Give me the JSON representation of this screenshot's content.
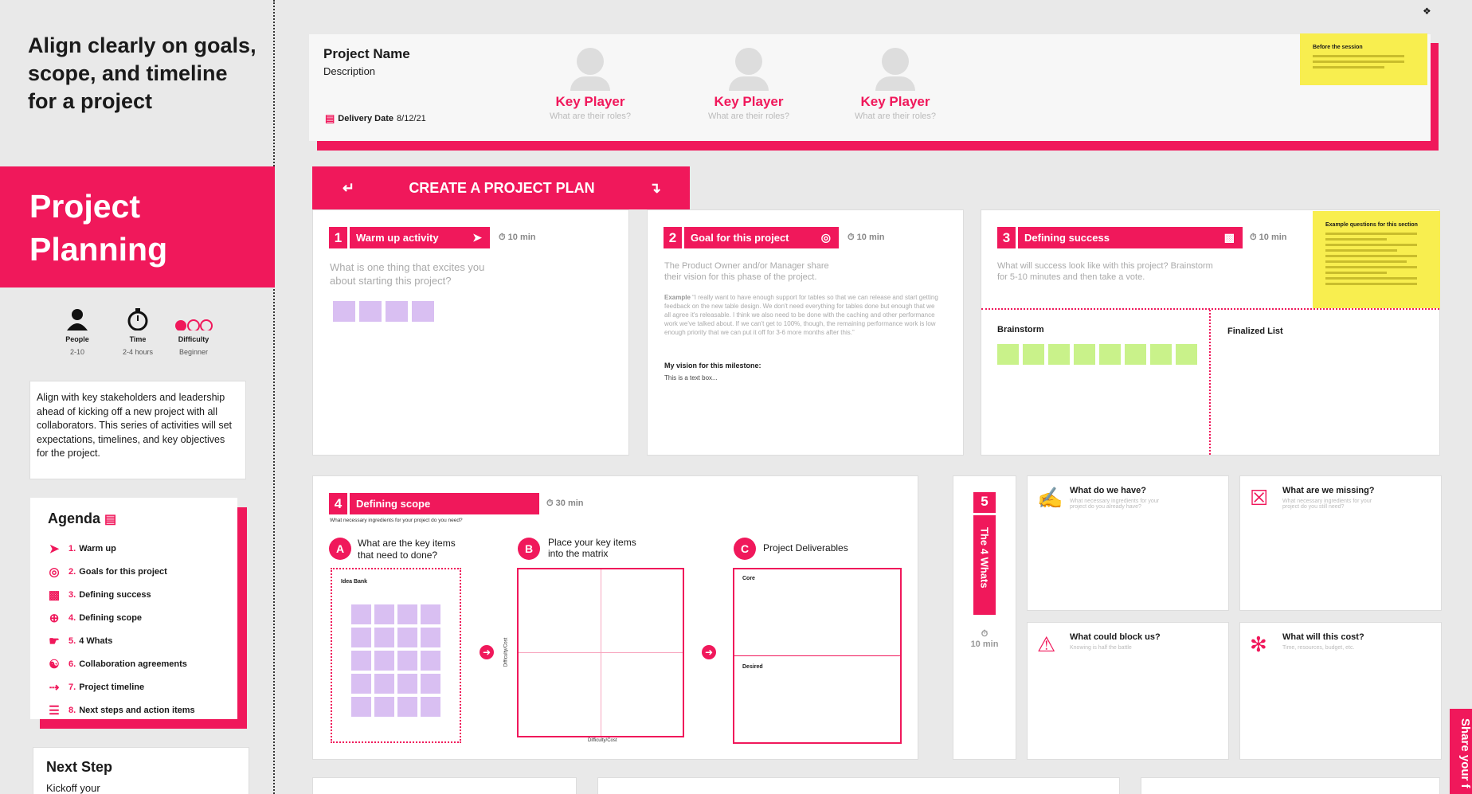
{
  "intro": {
    "title": "Align clearly on goals, scope, and timeline for a project"
  },
  "hero": {
    "title": "Project Planning"
  },
  "meta": [
    {
      "label": "People",
      "value": "2-10",
      "icon": "person-icon"
    },
    {
      "label": "Time",
      "value": "2-4 hours",
      "icon": "stopwatch-icon"
    },
    {
      "label": "Difficulty",
      "value": "Beginner",
      "icon": "difficulty-dots-icon"
    }
  ],
  "description": "Align with key stakeholders and leadership ahead of kicking off a new project with all collaborators. This series of activities will set expectations, timelines, and key objectives for the project.",
  "agenda": {
    "title": "Agenda",
    "items": [
      {
        "num": "1.",
        "label": "Warm up"
      },
      {
        "num": "2.",
        "label": "Goals for this project"
      },
      {
        "num": "3.",
        "label": "Defining success"
      },
      {
        "num": "4.",
        "label": "Defining scope"
      },
      {
        "num": "5.",
        "label": "4 Whats"
      },
      {
        "num": "6.",
        "label": "Collaboration agreements"
      },
      {
        "num": "7.",
        "label": "Project timeline"
      },
      {
        "num": "8.",
        "label": "Next steps and action items"
      }
    ]
  },
  "next_step": {
    "title": "Next Step",
    "text": "Kickoff your"
  },
  "project": {
    "name": "Project Name",
    "description": "Description",
    "delivery_label": "Delivery Date",
    "delivery_date": "8/12/21",
    "key_players": [
      {
        "title": "Key Player",
        "role": "What are their roles?"
      },
      {
        "title": "Key Player",
        "role": "What are their roles?"
      },
      {
        "title": "Key Player",
        "role": "What are their roles?"
      }
    ],
    "sticky_title": "Before the session"
  },
  "banner": {
    "label": "CREATE A PROJECT PLAN"
  },
  "steps": {
    "s1": {
      "num": "1",
      "title": "Warm up activity",
      "time": "10 min",
      "prompt": "What is one thing that excites you about starting this project?"
    },
    "s2": {
      "num": "2",
      "title": "Goal for this project",
      "time": "10 min",
      "prompt": "The Product Owner and/or Manager share their vision for this phase of the project.",
      "example_label": "Example",
      "example": "“I really want to have enough support for tables so that we can release and start getting feedback on the new table design. We don't need everything for tables done but enough that we all agree it's releasable. I think we also need to be done with the caching and other performance work we've talked about. If we can't get to 100%, though, the remaining performance work is low enough priority that we can put it off for 3-6 more months after this.”",
      "vision_label": "My vision for this milestone:",
      "vision_text": "This is a text box..."
    },
    "s3": {
      "num": "3",
      "title": "Defining success",
      "time": "10 min",
      "prompt": "What will success look like with this project? Brainstorm for 5-10 minutes and then take a vote.",
      "brainstorm": "Brainstorm",
      "finalized": "Finalized List",
      "sticky_title": "Example questions for this section"
    },
    "s4": {
      "num": "4",
      "title": "Defining scope",
      "time": "30 min",
      "prompt": "What necessary ingredients for your project do you need?",
      "a_label": "A",
      "a_text": "What are the key items that need to done?",
      "idea_bank": "Idea Bank",
      "b_label": "B",
      "b_text": "Place your key items into the matrix",
      "matrix_x": "Difficulty/Cost",
      "matrix_y": "Difficulty/Cost",
      "c_label": "C",
      "c_text": "Project Deliverables",
      "core": "Core",
      "desired": "Desired"
    },
    "s5": {
      "num": "5",
      "title": "The 4 Whats",
      "time": "10 min",
      "cards": [
        {
          "title": "What do we have?",
          "sub": "What necessary ingredients for your project do you already have?",
          "icon": "hand-document-icon"
        },
        {
          "title": "What are we missing?",
          "sub": "What necessary ingredients for your project do you still need?",
          "icon": "missing-document-icon"
        },
        {
          "title": "What could block us?",
          "sub": "Knowing is half the battle",
          "icon": "warning-icon"
        },
        {
          "title": "What will this cost?",
          "sub": "Time, resources, budget, etc.",
          "icon": "price-tag-icon"
        }
      ]
    }
  },
  "share": {
    "label": "Share your f"
  },
  "colors": {
    "accent": "#f0185b",
    "sticky": "#f8ee4f",
    "purple_sticky": "#d9bff2",
    "green_sticky": "#c9f28a"
  }
}
